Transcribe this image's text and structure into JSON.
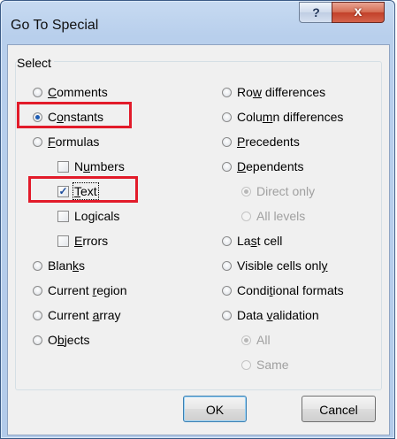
{
  "window": {
    "title": "Go To Special",
    "help_glyph": "?",
    "close_glyph": "x"
  },
  "group": {
    "label": "Select"
  },
  "left_options": [
    {
      "label": "Comments",
      "key": "C",
      "rest": "omments",
      "checked": false,
      "type": "radio"
    },
    {
      "label": "Constants",
      "key": "o",
      "pre": "C",
      "rest": "nstants",
      "checked": true,
      "type": "radio"
    },
    {
      "label": "Formulas",
      "key": "F",
      "rest": "ormulas",
      "checked": false,
      "type": "radio"
    },
    {
      "label": "Numbers",
      "pre": "N",
      "key": "u",
      "rest": "mbers",
      "checked": false,
      "type": "checkbox"
    },
    {
      "label": "Text",
      "key": "T",
      "rest": "ext",
      "checked": true,
      "type": "checkbox"
    },
    {
      "label": "Logicals",
      "pre": "Lo",
      "key": "g",
      "rest": "icals",
      "checked": false,
      "type": "checkbox"
    },
    {
      "label": "Errors",
      "key": "E",
      "rest": "rrors",
      "checked": false,
      "type": "checkbox"
    },
    {
      "label": "Blanks",
      "pre": "Blan",
      "key": "k",
      "rest": "s",
      "checked": false,
      "type": "radio"
    },
    {
      "label": "Current region",
      "pre": "Current ",
      "key": "r",
      "rest": "egion",
      "checked": false,
      "type": "radio"
    },
    {
      "label": "Current array",
      "pre": "Current ",
      "key": "a",
      "rest": "rray",
      "checked": false,
      "type": "radio"
    },
    {
      "label": "Objects",
      "pre": "O",
      "key": "b",
      "rest": "jects",
      "checked": false,
      "type": "radio"
    }
  ],
  "right_options": [
    {
      "label": "Row differences",
      "pre": "Ro",
      "key": "w",
      "rest": " differences",
      "checked": false,
      "type": "radio"
    },
    {
      "label": "Column differences",
      "pre": "Colu",
      "key": "m",
      "rest": "n differences",
      "checked": false,
      "type": "radio"
    },
    {
      "label": "Precedents",
      "key": "P",
      "rest": "recedents",
      "checked": false,
      "type": "radio"
    },
    {
      "label": "Dependents",
      "key": "D",
      "rest": "ependents",
      "checked": false,
      "type": "radio"
    },
    {
      "label": "Direct only",
      "checked": true,
      "type": "radio",
      "disabled": true
    },
    {
      "label": "All levels",
      "checked": false,
      "type": "radio",
      "disabled": true
    },
    {
      "label": "Last cell",
      "pre": "La",
      "key": "s",
      "rest": "t cell",
      "checked": false,
      "type": "radio"
    },
    {
      "label": "Visible cells only",
      "pre": "Visible cells onl",
      "key": "y",
      "rest": "",
      "checked": false,
      "type": "radio"
    },
    {
      "label": "Conditional formats",
      "pre": "Condi",
      "key": "t",
      "rest": "ional formats",
      "checked": false,
      "type": "radio"
    },
    {
      "label": "Data validation",
      "pre": "Data ",
      "key": "v",
      "rest": "alidation",
      "checked": false,
      "type": "radio"
    },
    {
      "label": "All",
      "checked": true,
      "type": "radio",
      "disabled": true
    },
    {
      "label": "Same",
      "checked": false,
      "type": "radio",
      "disabled": true
    }
  ],
  "buttons": {
    "ok": "OK",
    "cancel": "Cancel"
  },
  "colors": {
    "highlight": "#e21b2a",
    "accent": "#1c5bb3"
  }
}
